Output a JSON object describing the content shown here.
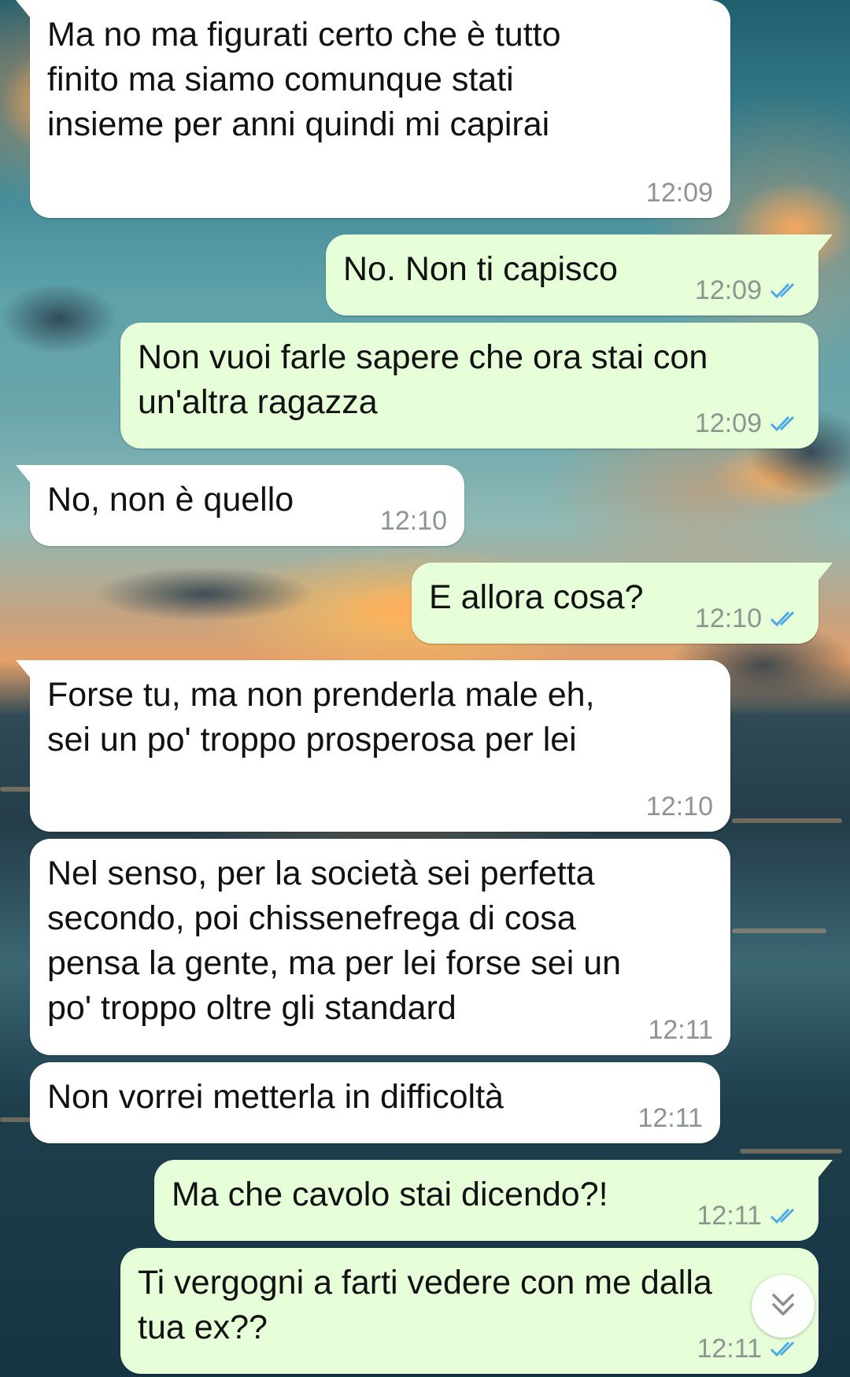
{
  "colors": {
    "incoming_bubble": "#ffffff",
    "outgoing_bubble": "#e6ffd9",
    "timestamp": "#8d958f",
    "read_ticks": "#4fa8e8"
  },
  "icons": {
    "read_receipt": "double-check-icon",
    "scroll_down": "double-chevron-down-icon"
  },
  "messages": [
    {
      "direction": "in",
      "text": "Ma no ma figurati certo che è tutto\nfinito ma siamo comunque stati\ninsieme per anni quindi mi capirai",
      "time": "12:09"
    },
    {
      "direction": "out",
      "text": "No. Non ti capisco",
      "time": "12:09",
      "status": "read"
    },
    {
      "direction": "out",
      "text": "Non vuoi farle sapere che ora stai con\nun'altra ragazza",
      "time": "12:09",
      "status": "read"
    },
    {
      "direction": "in",
      "text": "No, non è quello",
      "time": "12:10"
    },
    {
      "direction": "out",
      "text": "E allora cosa?",
      "time": "12:10",
      "status": "read"
    },
    {
      "direction": "in",
      "text": "Forse tu, ma non prenderla male eh,\nsei un po' troppo prosperosa per lei",
      "time": "12:10"
    },
    {
      "direction": "in",
      "text": "Nel senso, per la società sei perfetta\nsecondo, poi chissenefrega di cosa\npensa la gente, ma per lei forse sei un\npo' troppo oltre gli standard",
      "time": "12:11"
    },
    {
      "direction": "in",
      "text": "Non vorrei metterla in difficoltà",
      "time": "12:11"
    },
    {
      "direction": "out",
      "text": "Ma che cavolo stai dicendo?!",
      "time": "12:11",
      "status": "read"
    },
    {
      "direction": "out",
      "text": "Ti vergogni a farti vedere con me dalla\ntua ex??",
      "time": "12:11",
      "status": "read"
    }
  ]
}
